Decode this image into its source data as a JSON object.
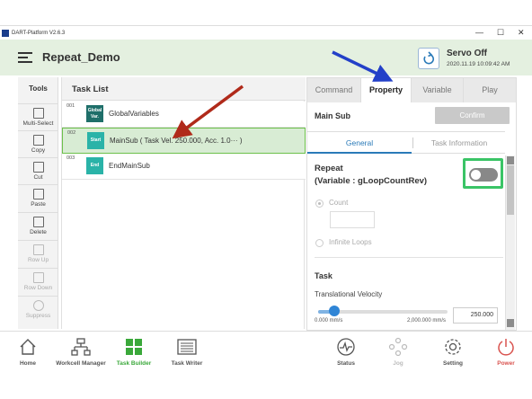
{
  "window": {
    "title": "DART-Platform V2.6.3",
    "controls": [
      "—",
      "☐",
      "✕"
    ]
  },
  "header": {
    "project_title": "Repeat_Demo",
    "servo_status": "Servo Off",
    "timestamp": "2020.11.19 10:09:42 AM"
  },
  "tools": {
    "title": "Tools",
    "items": [
      {
        "label": "Multi-Select"
      },
      {
        "label": "Copy"
      },
      {
        "label": "Cut"
      },
      {
        "label": "Paste"
      },
      {
        "label": "Delete"
      },
      {
        "label": "Row Up"
      },
      {
        "label": "Row Down"
      },
      {
        "label": "Suppress"
      }
    ]
  },
  "task_list": {
    "title": "Task List",
    "rows": [
      {
        "num": "001",
        "badge": "Global Var.",
        "badge_color": "#1f6f6a",
        "label": "GlobalVariables"
      },
      {
        "num": "002",
        "badge": "Start",
        "badge_color": "#2ab3a8",
        "label": "MainSub  ( Task Vel. 250.000, Acc. 1.0··· )"
      },
      {
        "num": "003",
        "badge": "End",
        "badge_color": "#2ab3a8",
        "label": "EndMainSub"
      }
    ]
  },
  "panel": {
    "tabs": [
      "Command",
      "Property",
      "Variable",
      "Play"
    ],
    "active_tab": "Property",
    "heading": "Main Sub",
    "confirm_label": "Confirm",
    "subtabs": {
      "general": "General",
      "info": "Task Information"
    },
    "repeat_title": "Repeat",
    "repeat_variable": "(Variable : gLoopCountRev)",
    "repeat_enabled": false,
    "count_label": "Count",
    "count_value": "",
    "infinite_label": "Infinite Loops",
    "task_title": "Task",
    "tv_label": "Translational Velocity",
    "slider_min": "0.000 mm/s",
    "slider_max": "2,000.000 mm/s",
    "velocity_value": "250.000",
    "velocity_fraction": 0.125
  },
  "bottom_nav": [
    {
      "label": "Home",
      "icon": "home-icon"
    },
    {
      "label": "Workcell Manager",
      "icon": "workcell-icon"
    },
    {
      "label": "Task Builder",
      "icon": "task-builder-icon"
    },
    {
      "label": "Task Writer",
      "icon": "task-writer-icon"
    },
    {
      "label": "Status",
      "icon": "status-icon"
    },
    {
      "label": "Jog",
      "icon": "jog-icon"
    },
    {
      "label": "Setting",
      "icon": "gear-icon"
    },
    {
      "label": "Power",
      "icon": "power-icon"
    }
  ],
  "colors": {
    "accent_green": "#3aa83a",
    "highlight_green": "#3ac466",
    "blue": "#2a7ab8",
    "header_bg": "#e4f0e0",
    "arrow_red": "#b02a1a",
    "arrow_blue": "#2340c8"
  }
}
